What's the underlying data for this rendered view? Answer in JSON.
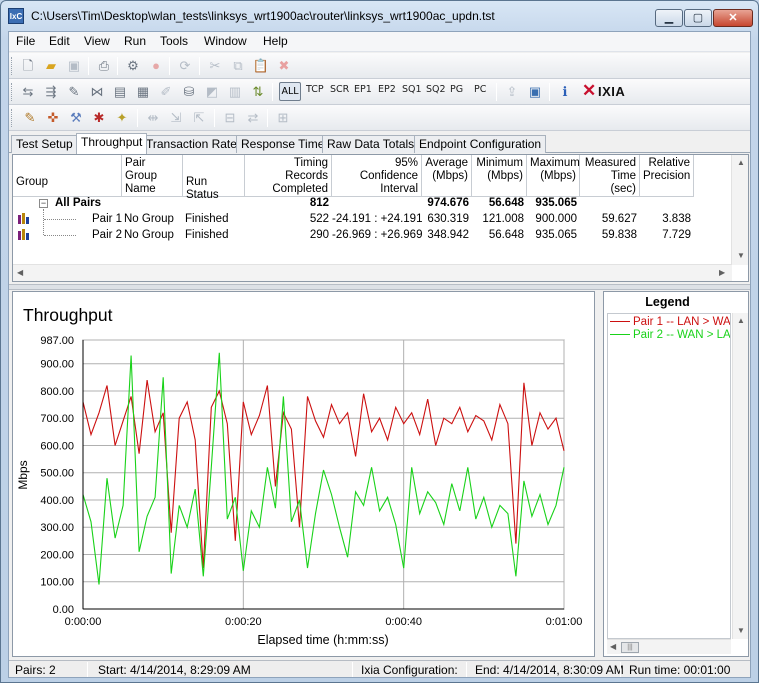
{
  "window": {
    "title": "C:\\Users\\Tim\\Desktop\\wlan_tests\\linksys_wrt1900ac\\router\\linksys_wrt1900ac_updn.tst",
    "app_icon_text": "IxC"
  },
  "menu": [
    "File",
    "Edit",
    "View",
    "Run",
    "Tools",
    "Window",
    "Help"
  ],
  "toolbar_protocols": {
    "all": "ALL",
    "tcp": "TCP",
    "scr": "SCR",
    "ep1": "EP1",
    "ep2": "EP2",
    "sq1": "SQ1",
    "sq2": "SQ2",
    "pg": "PG",
    "pc": "PC"
  },
  "brand": {
    "mark": "✕",
    "name": "IXIA"
  },
  "tabs": [
    "Test Setup",
    "Throughput",
    "Transaction Rate",
    "Response Time",
    "Raw Data Totals",
    "Endpoint Configuration"
  ],
  "active_tab": "Throughput",
  "grid": {
    "headers": {
      "group": "Group",
      "pair_group_name": "Pair Group Name",
      "run_status": "Run Status",
      "timing_records": "Timing Records Completed",
      "confidence": "95% Confidence Interval",
      "average": "Average (Mbps)",
      "minimum": "Minimum (Mbps)",
      "maximum": "Maximum (Mbps)",
      "measured_time": "Measured Time (sec)",
      "precision": "Relative Precision"
    },
    "all_pairs": {
      "label": "All Pairs",
      "timing_records": "812",
      "average": "974.676",
      "minimum": "56.648",
      "maximum": "935.065"
    },
    "rows": [
      {
        "pair": "Pair 1",
        "group": "No Group",
        "status": "Finished",
        "records": "522",
        "confidence": "-24.191 : +24.191",
        "average": "630.319",
        "minimum": "121.008",
        "maximum": "900.000",
        "time": "59.627",
        "precision": "3.838"
      },
      {
        "pair": "Pair 2",
        "group": "No Group",
        "status": "Finished",
        "records": "290",
        "confidence": "-26.969 : +26.969",
        "average": "348.942",
        "minimum": "56.648",
        "maximum": "935.065",
        "time": "59.838",
        "precision": "7.729"
      }
    ]
  },
  "legend": {
    "title": "Legend",
    "entries": [
      {
        "label": "Pair 1 -- LAN > WAN",
        "color": "#cc1010"
      },
      {
        "label": "Pair 2 -- WAN > LAN",
        "color": "#19d219"
      }
    ]
  },
  "status": {
    "pairs": "Pairs: 2",
    "start": "Start: 4/14/2014, 8:29:09 AM",
    "ixia_config": "Ixia Configuration:",
    "end": "End: 4/14/2014, 8:30:09 AM",
    "run_time": "Run time: 00:01:00"
  },
  "chart_data": {
    "type": "line",
    "title": "Throughput",
    "xlabel": "Elapsed time (h:mm:ss)",
    "ylabel": "Mbps",
    "xlim": [
      0,
      60
    ],
    "ylim": [
      0,
      987
    ],
    "x_ticks": [
      "0:00:00",
      "0:00:20",
      "0:00:40",
      "0:01:00"
    ],
    "y_ticks": [
      "0.00",
      "100.00",
      "200.00",
      "300.00",
      "400.00",
      "500.00",
      "600.00",
      "700.00",
      "800.00",
      "900.00",
      "987.00"
    ],
    "grid": true,
    "legend_position": "right panel",
    "series": [
      {
        "name": "Pair 1 -- LAN > WAN",
        "color": "#cc1010",
        "x": [
          0,
          1,
          2,
          3,
          4,
          5,
          6,
          7,
          8,
          9,
          10,
          11,
          12,
          13,
          14,
          15,
          16,
          17,
          18,
          19,
          20,
          21,
          22,
          23,
          24,
          25,
          26,
          27,
          28,
          29,
          30,
          31,
          32,
          33,
          34,
          35,
          36,
          37,
          38,
          39,
          40,
          41,
          42,
          43,
          44,
          45,
          46,
          47,
          48,
          49,
          50,
          51,
          52,
          53,
          54,
          55,
          56,
          57,
          58,
          59,
          60
        ],
        "y": [
          760,
          640,
          720,
          820,
          600,
          690,
          780,
          570,
          840,
          650,
          720,
          280,
          700,
          760,
          620,
          150,
          740,
          800,
          680,
          250,
          760,
          640,
          710,
          820,
          450,
          720,
          660,
          300,
          780,
          690,
          630,
          750,
          680,
          720,
          560,
          790,
          650,
          700,
          620,
          740,
          680,
          720,
          640,
          770,
          600,
          700,
          680,
          740,
          650,
          710,
          690,
          620,
          750,
          680,
          240,
          830,
          600,
          720,
          660,
          700,
          580
        ]
      },
      {
        "name": "Pair 2 -- WAN > LAN",
        "color": "#19d219",
        "x": [
          0,
          1,
          2,
          3,
          4,
          5,
          6,
          7,
          8,
          9,
          10,
          11,
          12,
          13,
          14,
          15,
          16,
          17,
          18,
          19,
          20,
          21,
          22,
          23,
          24,
          25,
          26,
          27,
          28,
          29,
          30,
          31,
          32,
          33,
          34,
          35,
          36,
          37,
          38,
          39,
          40,
          41,
          42,
          43,
          44,
          45,
          46,
          47,
          48,
          49,
          50,
          51,
          52,
          53,
          54,
          55,
          56,
          57,
          58,
          59,
          60
        ],
        "y": [
          420,
          320,
          90,
          480,
          260,
          380,
          930,
          210,
          340,
          410,
          850,
          130,
          380,
          300,
          440,
          120,
          520,
          940,
          330,
          410,
          140,
          360,
          300,
          520,
          370,
          780,
          320,
          400,
          150,
          350,
          510,
          420,
          300,
          190,
          430,
          380,
          520,
          360,
          410,
          310,
          150,
          520,
          350,
          430,
          390,
          310,
          460,
          360,
          520,
          330,
          410,
          300,
          380,
          350,
          120,
          470,
          340,
          420,
          310,
          380,
          520
        ]
      }
    ]
  }
}
